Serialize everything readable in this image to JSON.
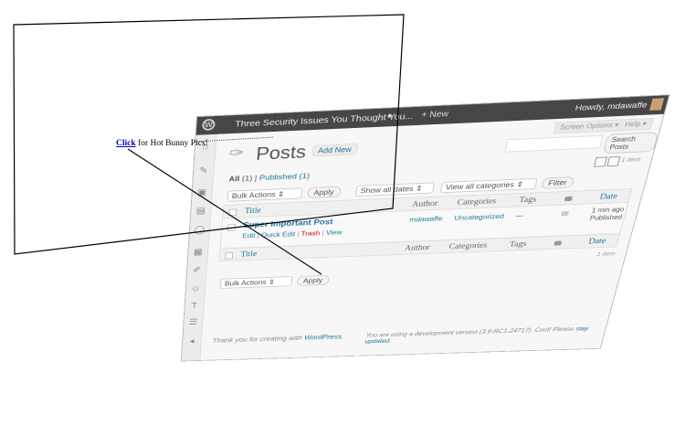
{
  "admin_bar": {
    "site_title": "Three Security Issues You Thought You...",
    "new_label": "+ New",
    "howdy": "Howdy, mdawaffe"
  },
  "screen_options": "Screen Options ▾",
  "help": "Help ▾",
  "page_title": "Posts",
  "add_new": "Add New",
  "search_button": "Search Posts",
  "filters": {
    "all": "All",
    "all_count": "(1)",
    "sep": "|",
    "published": "Published (1)"
  },
  "items_count": "1 item",
  "toolbar": {
    "bulk_actions": "Bulk Actions",
    "apply": "Apply",
    "dates": "Show all dates",
    "categories": "View all categories",
    "filter": "Filter"
  },
  "columns": {
    "title": "Title",
    "author": "Author",
    "categories": "Categories",
    "tags": "Tags",
    "date": "Date"
  },
  "post": {
    "title": "Super Important Post",
    "edit": "Edit",
    "quick_edit": "Quick Edit",
    "trash": "Trash",
    "view": "View",
    "author": "mdawaffe",
    "category": "Uncategorized",
    "tags": "—",
    "date_ago": "1 min ago",
    "status": "Published"
  },
  "footer": {
    "thanks_prefix": "Thank you for creating with",
    "wordpress": "WordPress",
    "dev_notice": "You are using a development version (3.6-RC1-24717). Cool! Please",
    "stay_updated": "stay updated."
  },
  "overlay": {
    "link_text": "Click",
    "text": "for Hot Bunny Pics!"
  },
  "icons": {
    "wp_logo": "wordpress-logo-icon",
    "pushpin": "pushpin-icon",
    "comment": "comment-bubble-icon"
  }
}
